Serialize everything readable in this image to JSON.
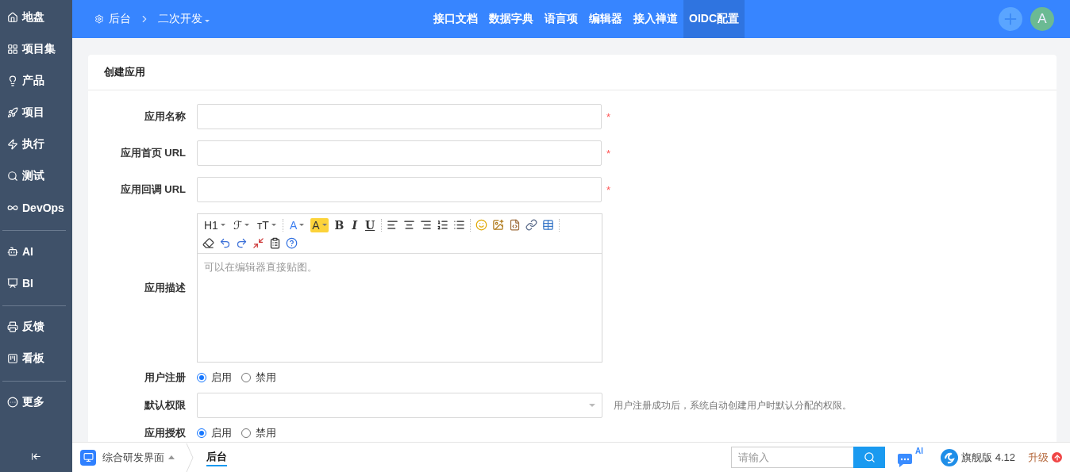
{
  "sidebar": {
    "groups": [
      [
        {
          "kind": "home",
          "label": "地盘"
        },
        {
          "kind": "grid",
          "label": "项目集"
        },
        {
          "kind": "bulb",
          "label": "产品"
        },
        {
          "kind": "rocket",
          "label": "项目"
        },
        {
          "kind": "run",
          "label": "执行"
        },
        {
          "kind": "search",
          "label": "测试"
        },
        {
          "kind": "infinity",
          "label": "DevOps"
        }
      ],
      [
        {
          "kind": "bot",
          "label": "AI"
        },
        {
          "kind": "board",
          "label": "BI"
        }
      ],
      [
        {
          "kind": "printer",
          "label": "反馈"
        },
        {
          "kind": "kanban",
          "label": "看板"
        }
      ],
      [
        {
          "kind": "more",
          "label": "更多"
        }
      ]
    ]
  },
  "topbar": {
    "breadcrumb": {
      "root": "后台",
      "current": "二次开发"
    },
    "tabs": [
      {
        "label": "接口文档",
        "selected": false
      },
      {
        "label": "数据字典",
        "selected": false
      },
      {
        "label": "语言项",
        "selected": false
      },
      {
        "label": "编辑器",
        "selected": false
      },
      {
        "label": "接入禅道",
        "selected": false
      },
      {
        "label": "OIDC配置",
        "selected": true
      }
    ],
    "avatar": "A"
  },
  "card": {
    "title": "创建应用",
    "fields": [
      {
        "kind": "input",
        "label": "应用名称",
        "required_mark": "*"
      },
      {
        "kind": "input",
        "label": "应用首页 URL",
        "required_mark": "*"
      },
      {
        "kind": "input",
        "label": "应用回调 URL",
        "required_mark": "*"
      },
      {
        "kind": "editor",
        "label": "应用描述",
        "placeholder": "可以在编辑器直接贴图。",
        "toolbar": [
          [
            {
              "kind": "text",
              "label": "H1",
              "dropdown": true
            },
            {
              "kind": "text",
              "label": "ℱ",
              "dropdown": true
            },
            {
              "kind": "text",
              "label": "ᴛT",
              "dropdown": true
            },
            {
              "kind": "sep"
            },
            {
              "kind": "color",
              "label": "A",
              "dropdown": true
            },
            {
              "kind": "highlight",
              "label": "A",
              "dropdown": true
            },
            {
              "kind": "bold",
              "label": "B"
            },
            {
              "kind": "italic",
              "label": "I"
            },
            {
              "kind": "underline",
              "label": "U"
            },
            {
              "kind": "sep"
            },
            {
              "kind": "align-left"
            },
            {
              "kind": "align-center"
            },
            {
              "kind": "align-right"
            },
            {
              "kind": "list-ordered"
            },
            {
              "kind": "list"
            },
            {
              "kind": "sep"
            },
            {
              "kind": "smile"
            },
            {
              "kind": "image"
            },
            {
              "kind": "code"
            },
            {
              "kind": "link"
            },
            {
              "kind": "table"
            },
            {
              "kind": "sep"
            }
          ],
          [
            {
              "kind": "eraser"
            },
            {
              "kind": "undo"
            },
            {
              "kind": "redo"
            },
            {
              "kind": "fullscreen"
            },
            {
              "kind": "paste"
            },
            {
              "kind": "help"
            }
          ]
        ]
      },
      {
        "kind": "radio",
        "label": "用户注册",
        "options": [
          {
            "label": "启用",
            "selected": true
          },
          {
            "label": "禁用",
            "selected": false
          }
        ]
      },
      {
        "kind": "select",
        "label": "默认权限",
        "hint": "用户注册成功后，系统自动创建用户时默认分配的权限。"
      },
      {
        "kind": "radio",
        "label": "应用授权",
        "options": [
          {
            "label": "启用",
            "selected": true
          },
          {
            "label": "禁用",
            "selected": false
          }
        ]
      }
    ]
  },
  "bottombar": {
    "app": "综合研发界面",
    "tab": "后台",
    "search_placeholder": "请输入",
    "ai_badge": "AI",
    "edition": "旗舰版 4.12",
    "upgrade": "升级"
  }
}
